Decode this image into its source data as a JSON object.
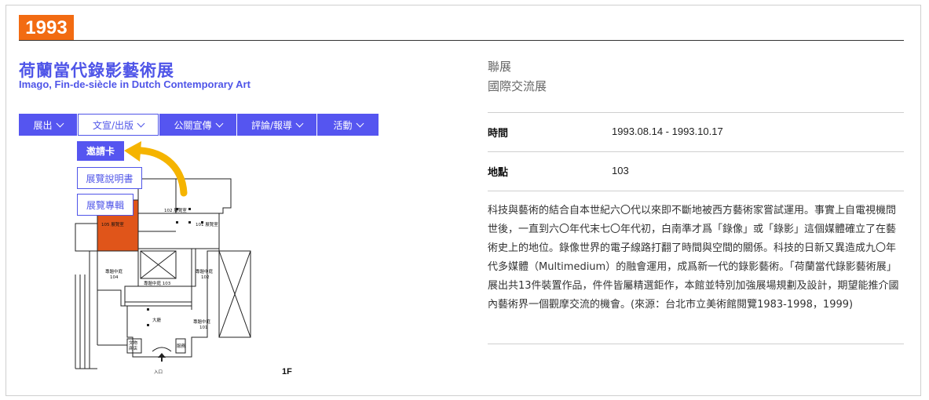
{
  "year": "1993",
  "exhibition": {
    "title_zh": "荷蘭當代錄影藝術展",
    "title_en": "Imago, Fin-de-siècle in Dutch Contemporary Art"
  },
  "nav": [
    {
      "label": "展出"
    },
    {
      "label": "文宣/出版"
    },
    {
      "label": "公關宣傳"
    },
    {
      "label": "評論/報導"
    },
    {
      "label": "活動"
    }
  ],
  "dropdown": [
    {
      "label": "邀請卡"
    },
    {
      "label": "展覽說明書"
    },
    {
      "label": "展覽專輯"
    }
  ],
  "floorplan": {
    "room_102": "102 展覽室",
    "room_101": "101 展覽室",
    "room_105": "105 展覽室",
    "gallery_104": "專題中庭\n104",
    "gallery_103": "專題中庭 103",
    "gallery_102": "專題中庭\n102",
    "gallery_101": "專題中庭\n101",
    "hall": "大廳",
    "shop": "文物\n商店",
    "service": "服務",
    "entrance": "入口",
    "floor": "1F"
  },
  "categories": [
    "聯展",
    "國際交流展"
  ],
  "info": {
    "time_label": "時間",
    "time_value": "1993.08.14 - 1993.10.17",
    "place_label": "地點",
    "place_value": "103"
  },
  "description": "科技與藝術的結合自本世紀六〇代以來即不斷地被西方藝術家嘗試運用。事實上自電視機問世後，一直到六〇年代末七〇年代初，白南準才爲「錄像」或「錄影」這個媒體確立了在藝術史上的地位。錄像世界的電子線路打翻了時間與空間的關係。科技的日新又異造成九〇年代多媒體（Multimedium）的融會運用，成爲新一代的錄影藝術。「荷蘭當代錄影藝術展」展出共13件裝置作品，件件皆屬精選鉅作，本館並特別加強展場規劃及設計，期望能推介國內藝術界一個觀摩交流的機會。(來源：台北市立美術館閱覽1983-1998，1999)",
  "colors": {
    "accent": "#4f55e8",
    "nav_bg": "#5555f0",
    "badge": "#f26b12",
    "highlight_room": "#e0551a",
    "arrow": "#f5b400"
  }
}
